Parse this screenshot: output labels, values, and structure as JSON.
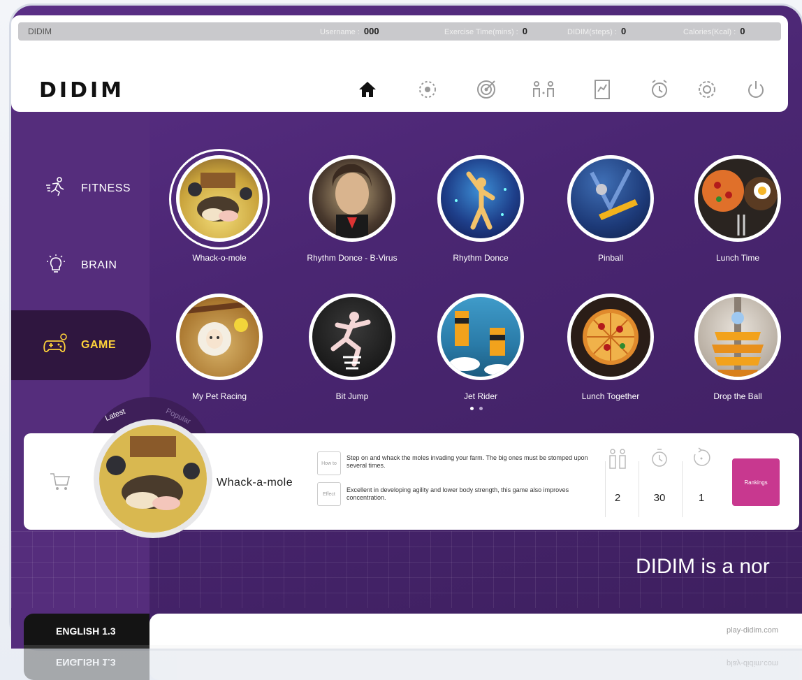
{
  "status": {
    "brand": "DIDIM",
    "username_label": "Username",
    "username_value": "000",
    "exercise_label": "Exercise Time(mins)",
    "exercise_value": "0",
    "steps_label": "DIDIM(steps)",
    "steps_value": "0",
    "calories_label": "Calories(Kcal)",
    "calories_value": "0"
  },
  "header": {
    "logo": "DIDIM"
  },
  "nav_icons": [
    "home-icon",
    "compass-icon",
    "target-icon",
    "versus-icon",
    "report-icon",
    "alarm-icon",
    "gear-icon",
    "power-icon"
  ],
  "sidebar": {
    "items": [
      {
        "label": "FITNESS",
        "icon": "runner-icon"
      },
      {
        "label": "BRAIN",
        "icon": "bulb-icon"
      },
      {
        "label": "GAME",
        "icon": "gamepad-icon"
      }
    ]
  },
  "games": [
    {
      "title": "Whack-o-mole"
    },
    {
      "title": "Rhythm Donce - B-Virus"
    },
    {
      "title": "Rhythm Donce"
    },
    {
      "title": "Pinball"
    },
    {
      "title": "Lunch Time"
    },
    {
      "title": "My Pet Racing"
    },
    {
      "title": "Bit Jump"
    },
    {
      "title": "Jet Rider"
    },
    {
      "title": "Lunch Together"
    },
    {
      "title": "Drop the Ball"
    }
  ],
  "tabs": {
    "latest": "Latest",
    "popular": "Popular"
  },
  "detail": {
    "title": "Whack-a-mole",
    "tag_how": "How to",
    "tag_effect": "Effect",
    "how_text": "Step on and whack the moles invading your farm. The big ones must be stomped upon several times.",
    "effect_text": "Excellent in developing agility and lower body strength, this game also improves concentration.",
    "players": "2",
    "time": "30",
    "level": "1",
    "rankings": "Rankings",
    "shop": "SHOP"
  },
  "marquee": "DIDIM is a nor",
  "footer": {
    "lang": "ENGLISH 1.3",
    "site": "play-didim.com"
  }
}
